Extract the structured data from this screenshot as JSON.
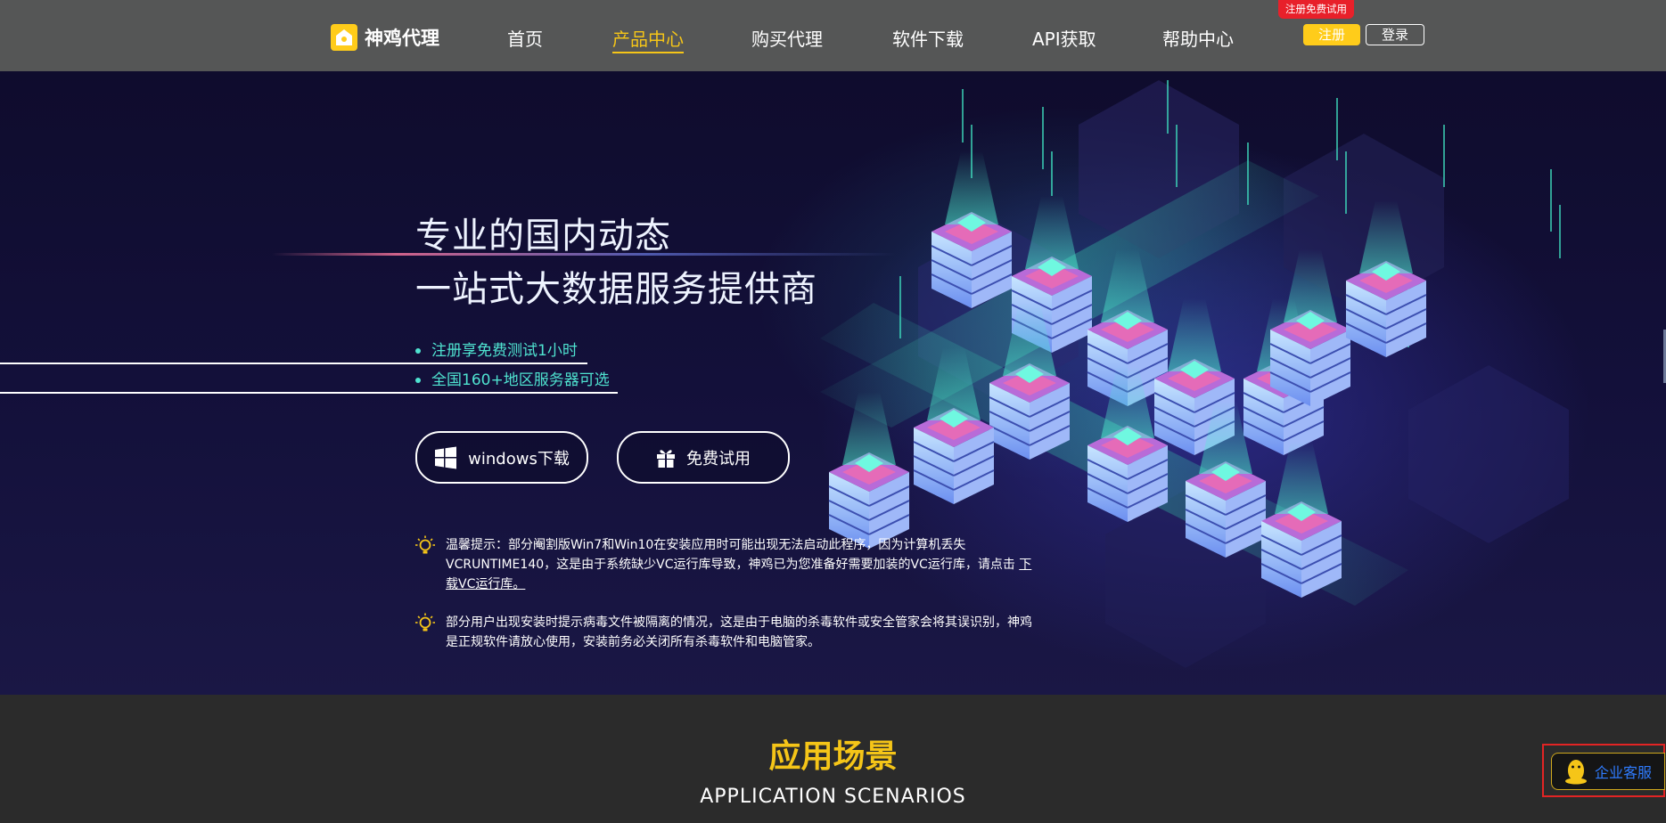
{
  "nav": {
    "logo_text": "神鸡代理",
    "items": [
      "首页",
      "产品中心",
      "购买代理",
      "软件下载",
      "API获取",
      "帮助中心"
    ],
    "active_item": "产品中心",
    "promo_badge": "注册免费试用",
    "register_label": "注册",
    "login_label": "登录"
  },
  "hero": {
    "headline_1": "专业的国内动态",
    "headline_2": "一站式大数据服务提供商",
    "features": [
      "注册享免费测试1小时",
      "全国160+地区服务器可选"
    ],
    "btn_windows": "windows下载",
    "btn_trial": "免费试用",
    "tip1_text": "温馨提示：部分阉割版Win7和Win10在安装应用时可能出现无法启动此程序，因为计算机丢失VCRUNTIME140，这是由于系统缺少VC运行库导致，神鸡已为您准备好需要加装的VC运行库，请点击",
    "tip1_link": "下载VC运行库。",
    "tip2_text": "部分用户出现安装时提示病毒文件被隔离的情况，这是由于电脑的杀毒软件或安全管家会将其误识别，神鸡是正规软件请放心使用，安装前务必关闭所有杀毒软件和电脑管家。"
  },
  "scenarios": {
    "title": "应用场景",
    "subtitle": "APPLICATION  SCENARIOS"
  },
  "service": {
    "label": "企业客服"
  },
  "colors": {
    "accent_yellow": "#f5c518",
    "feature_teal": "#4fe3d0",
    "badge_red": "#e8202a",
    "nav_bg": "#555656",
    "hero_bg": "#13103a"
  },
  "icons": [
    "logo-icon",
    "windows-icon",
    "gift-icon",
    "lightbulb-icon",
    "qq-penguin-icon"
  ]
}
